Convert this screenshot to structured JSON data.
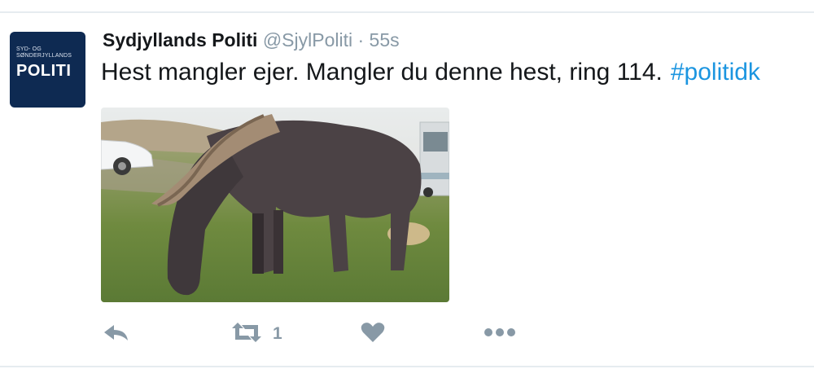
{
  "tweet": {
    "display_name": "Sydjyllands Politi",
    "handle": "@SjylPoliti",
    "separator": "·",
    "timestamp": "55s",
    "text": "Hest mangler ejer. Mangler du denne hest, ring 114.",
    "hashtag": "#politidk"
  },
  "avatar": {
    "line1": "SYD- OG",
    "line2": "SØNDERJYLLANDS",
    "line3": "POLITI",
    "bg_color": "#0e2a52"
  },
  "media": {
    "icon": "photo-of-dark-pony-grazing"
  },
  "actions": {
    "reply_icon": "reply-icon",
    "retweet_icon": "retweet-icon",
    "retweet_count": "1",
    "like_icon": "heart-icon",
    "more_icon": "more-dots-icon"
  },
  "colors": {
    "link": "#1b95e0",
    "muted": "#8899a6",
    "text": "#14171a"
  }
}
